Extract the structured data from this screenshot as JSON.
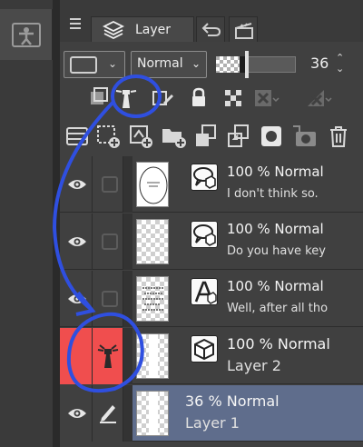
{
  "tabs": {
    "active_label": "Layer"
  },
  "properties": {
    "blend_mode": "Normal",
    "opacity_value": "36",
    "opacity_fraction": 0.36
  },
  "layers": [
    {
      "opacity_mode": "100 % Normal",
      "name": "I don't think so.",
      "type": "text-balloon"
    },
    {
      "opacity_mode": "100 % Normal",
      "name": "Do you have key",
      "type": "text-balloon"
    },
    {
      "opacity_mode": "100 % Normal",
      "name": "Well, after all tho",
      "type": "text"
    },
    {
      "opacity_mode": "100 % Normal",
      "name": "Layer 2",
      "type": "raster"
    },
    {
      "opacity_mode": "36 % Normal",
      "name": "Layer 1",
      "type": "raster"
    }
  ],
  "colors": {
    "accent_red": "#f04e4e",
    "selection_blue": "#5f6d8c",
    "annotation_blue": "#2f4fe0"
  }
}
